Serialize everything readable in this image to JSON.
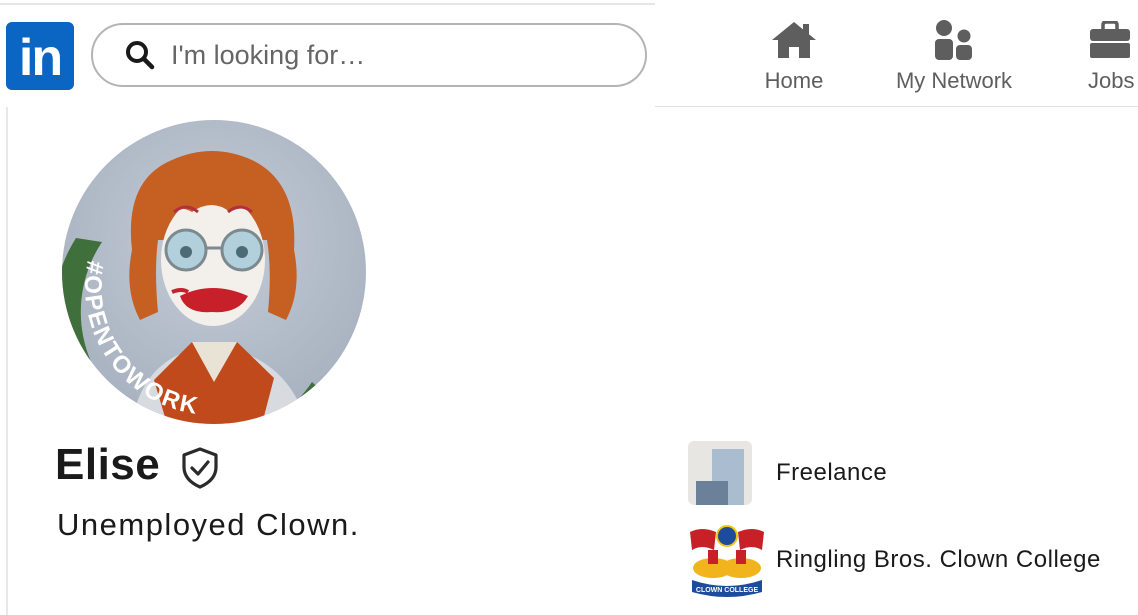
{
  "brand": {
    "logo_text": "in",
    "color": "#0a66c2"
  },
  "search": {
    "placeholder": "I'm looking for…",
    "value": ""
  },
  "nav": [
    {
      "label": "Home",
      "icon": "home-icon"
    },
    {
      "label": "My Network",
      "icon": "network-icon"
    },
    {
      "label": "Jobs",
      "icon": "briefcase-icon"
    }
  ],
  "profile": {
    "name": "Elise",
    "verified": true,
    "headline": "Unemployed Clown.",
    "badge_text": "#OPENTOWORK",
    "badge_color": "#3f6f3a"
  },
  "experience": [
    {
      "company": "Freelance",
      "icon": "generic-company-icon"
    },
    {
      "company": "Ringling Bros. Clown College",
      "icon": "ringling-logo",
      "logo_text": "CLOWN COLLEGE"
    }
  ]
}
